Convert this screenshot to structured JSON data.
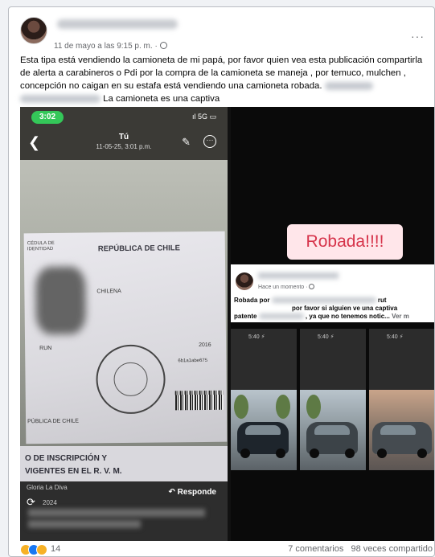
{
  "post": {
    "author_name": "",
    "timestamp": "11 de mayo a las 9:15 p. m. ·",
    "more_label": "···",
    "text_main": "Esta tipa está vendiendo la camioneta de mi papá, por favor quien vea esta publicación compartirla de alerta a carabineros o Pdi por la compra de la camioneta se maneja , por temuco, mulchen , concepción no caigan en su estafa está vendiendo una camioneta robada.",
    "text_second": "La camioneta es una captiva"
  },
  "left_screenshot": {
    "status_time": "3:02",
    "status_signal": "ıl 5G ▭",
    "chat_title": "Tú",
    "chat_date": "11-05-25, 3:01 p.m.",
    "card": {
      "cedula_label": "CÉDULA DE IDENTIDAD",
      "country": "REPÚBLICA DE CHILE",
      "nationality": "CHILENA",
      "run_label": "RUN",
      "year_fragment": "2016",
      "code_fragment": "6b1a1abe675",
      "publica_label": "PÚBLICA DE CHILE"
    },
    "doc_line1": "O DE INSCRIPCIÓN Y",
    "doc_line2": "VIGENTES EN EL R. V. M.",
    "sender": "Gloria La Diva",
    "sender_date": "2024",
    "reply_label": "Responde"
  },
  "right_screenshot": {
    "robada_label": "Robada!!!!",
    "mini_meta": "Hace un momento ·",
    "line1_start": "Robada por",
    "line1_end": "rut",
    "line2": "por favor si alguien ve una captiva",
    "line3_start": "patente",
    "line3_end": ", ya que no tenemos notic...",
    "ver_mas": "Ver m",
    "thumb_status": "5:40 ⚡"
  },
  "footer": {
    "reaction_count": "14",
    "comments": "7 comentarios",
    "shares": "98 veces compartido"
  }
}
